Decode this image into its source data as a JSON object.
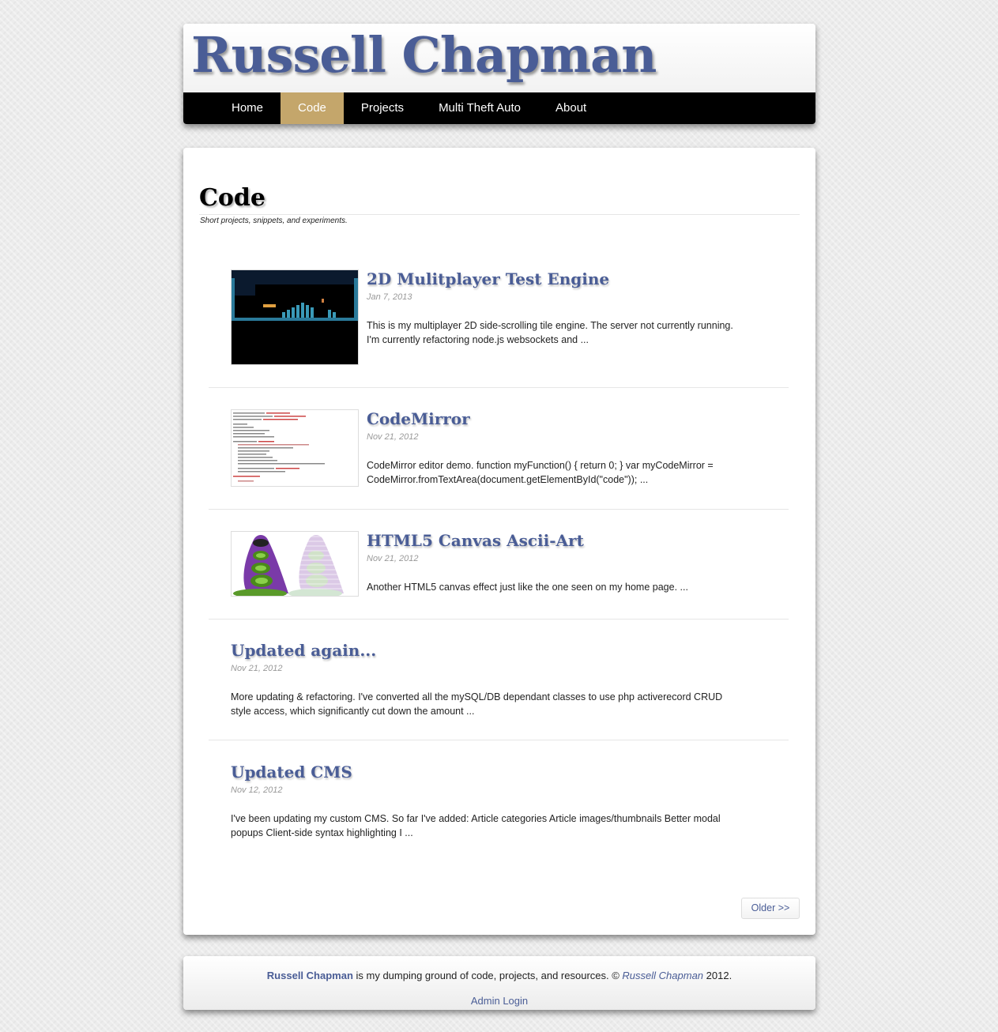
{
  "site": {
    "title": "Russell Chapman"
  },
  "nav": {
    "items": [
      {
        "label": "Home"
      },
      {
        "label": "Code",
        "active": true
      },
      {
        "label": "Projects"
      },
      {
        "label": "Multi Theft Auto"
      },
      {
        "label": "About"
      }
    ]
  },
  "page": {
    "title": "Code",
    "subtitle": "Short projects, snippets, and experiments."
  },
  "posts": [
    {
      "title": "2D Mulitplayer Test Engine",
      "date": "Jan 7, 2013",
      "excerpt": "This is my multiplayer 2D side-scrolling tile engine. The server not currently running. I'm currently refactoring node.js websockets and ...",
      "thumbnail": "game-screenshot"
    },
    {
      "title": "CodeMirror",
      "date": "Nov 21, 2012",
      "excerpt": "CodeMirror editor demo. function myFunction() { return 0; } var myCodeMirror = CodeMirror.fromTextArea(document.getElementById(\"code\")); ...",
      "thumbnail": "code-screenshot"
    },
    {
      "title": "HTML5 Canvas Ascii-Art",
      "date": "Nov 21, 2012",
      "excerpt": "Another HTML5 canvas effect just like the one seen on my home page. ...",
      "thumbnail": "purple-tentacle-image"
    },
    {
      "title": "Updated again...",
      "date": "Nov 21, 2012",
      "excerpt": "More updating & refactoring. I've converted all the mySQL/DB dependant classes to use php activerecord CRUD style access, which significantly cut down the amount ..."
    },
    {
      "title": "Updated CMS",
      "date": "Nov 12, 2012",
      "excerpt": "I've been updating my custom CMS. So far I've added: Article categories Article images/thumbnails Better modal popups Client-side syntax highlighting I ..."
    }
  ],
  "pagination": {
    "older_label": "Older >>"
  },
  "footer": {
    "name": "Russell Chapman",
    "text": " is my dumping ground of code, projects, and resources. © ",
    "copyright_name": "Russell Chapman",
    "year": " 2012.",
    "admin_label": "Admin Login"
  },
  "colors": {
    "brand": "#4a5d96",
    "nav_active": "#c4a66b",
    "nav_bg": "#000000"
  }
}
